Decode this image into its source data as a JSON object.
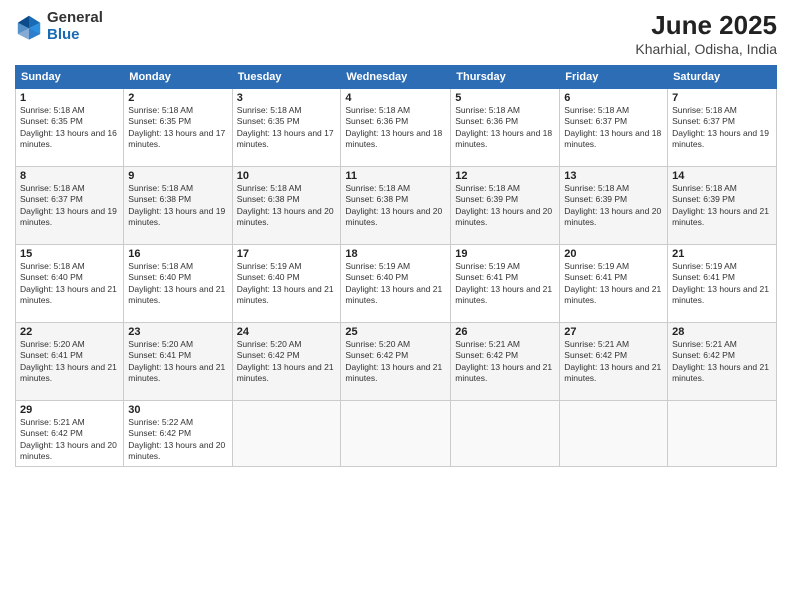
{
  "header": {
    "logo_general": "General",
    "logo_blue": "Blue",
    "month_title": "June 2025",
    "location": "Kharhial, Odisha, India"
  },
  "weekdays": [
    "Sunday",
    "Monday",
    "Tuesday",
    "Wednesday",
    "Thursday",
    "Friday",
    "Saturday"
  ],
  "weeks": [
    [
      {
        "day": "1",
        "sunrise": "5:18 AM",
        "sunset": "6:35 PM",
        "daylight": "13 hours and 16 minutes."
      },
      {
        "day": "2",
        "sunrise": "5:18 AM",
        "sunset": "6:35 PM",
        "daylight": "13 hours and 17 minutes."
      },
      {
        "day": "3",
        "sunrise": "5:18 AM",
        "sunset": "6:35 PM",
        "daylight": "13 hours and 17 minutes."
      },
      {
        "day": "4",
        "sunrise": "5:18 AM",
        "sunset": "6:36 PM",
        "daylight": "13 hours and 18 minutes."
      },
      {
        "day": "5",
        "sunrise": "5:18 AM",
        "sunset": "6:36 PM",
        "daylight": "13 hours and 18 minutes."
      },
      {
        "day": "6",
        "sunrise": "5:18 AM",
        "sunset": "6:37 PM",
        "daylight": "13 hours and 18 minutes."
      },
      {
        "day": "7",
        "sunrise": "5:18 AM",
        "sunset": "6:37 PM",
        "daylight": "13 hours and 19 minutes."
      }
    ],
    [
      {
        "day": "8",
        "sunrise": "5:18 AM",
        "sunset": "6:37 PM",
        "daylight": "13 hours and 19 minutes."
      },
      {
        "day": "9",
        "sunrise": "5:18 AM",
        "sunset": "6:38 PM",
        "daylight": "13 hours and 19 minutes."
      },
      {
        "day": "10",
        "sunrise": "5:18 AM",
        "sunset": "6:38 PM",
        "daylight": "13 hours and 20 minutes."
      },
      {
        "day": "11",
        "sunrise": "5:18 AM",
        "sunset": "6:38 PM",
        "daylight": "13 hours and 20 minutes."
      },
      {
        "day": "12",
        "sunrise": "5:18 AM",
        "sunset": "6:39 PM",
        "daylight": "13 hours and 20 minutes."
      },
      {
        "day": "13",
        "sunrise": "5:18 AM",
        "sunset": "6:39 PM",
        "daylight": "13 hours and 20 minutes."
      },
      {
        "day": "14",
        "sunrise": "5:18 AM",
        "sunset": "6:39 PM",
        "daylight": "13 hours and 21 minutes."
      }
    ],
    [
      {
        "day": "15",
        "sunrise": "5:18 AM",
        "sunset": "6:40 PM",
        "daylight": "13 hours and 21 minutes."
      },
      {
        "day": "16",
        "sunrise": "5:18 AM",
        "sunset": "6:40 PM",
        "daylight": "13 hours and 21 minutes."
      },
      {
        "day": "17",
        "sunrise": "5:19 AM",
        "sunset": "6:40 PM",
        "daylight": "13 hours and 21 minutes."
      },
      {
        "day": "18",
        "sunrise": "5:19 AM",
        "sunset": "6:40 PM",
        "daylight": "13 hours and 21 minutes."
      },
      {
        "day": "19",
        "sunrise": "5:19 AM",
        "sunset": "6:41 PM",
        "daylight": "13 hours and 21 minutes."
      },
      {
        "day": "20",
        "sunrise": "5:19 AM",
        "sunset": "6:41 PM",
        "daylight": "13 hours and 21 minutes."
      },
      {
        "day": "21",
        "sunrise": "5:19 AM",
        "sunset": "6:41 PM",
        "daylight": "13 hours and 21 minutes."
      }
    ],
    [
      {
        "day": "22",
        "sunrise": "5:20 AM",
        "sunset": "6:41 PM",
        "daylight": "13 hours and 21 minutes."
      },
      {
        "day": "23",
        "sunrise": "5:20 AM",
        "sunset": "6:41 PM",
        "daylight": "13 hours and 21 minutes."
      },
      {
        "day": "24",
        "sunrise": "5:20 AM",
        "sunset": "6:42 PM",
        "daylight": "13 hours and 21 minutes."
      },
      {
        "day": "25",
        "sunrise": "5:20 AM",
        "sunset": "6:42 PM",
        "daylight": "13 hours and 21 minutes."
      },
      {
        "day": "26",
        "sunrise": "5:21 AM",
        "sunset": "6:42 PM",
        "daylight": "13 hours and 21 minutes."
      },
      {
        "day": "27",
        "sunrise": "5:21 AM",
        "sunset": "6:42 PM",
        "daylight": "13 hours and 21 minutes."
      },
      {
        "day": "28",
        "sunrise": "5:21 AM",
        "sunset": "6:42 PM",
        "daylight": "13 hours and 21 minutes."
      }
    ],
    [
      {
        "day": "29",
        "sunrise": "5:21 AM",
        "sunset": "6:42 PM",
        "daylight": "13 hours and 20 minutes."
      },
      {
        "day": "30",
        "sunrise": "5:22 AM",
        "sunset": "6:42 PM",
        "daylight": "13 hours and 20 minutes."
      },
      null,
      null,
      null,
      null,
      null
    ]
  ]
}
